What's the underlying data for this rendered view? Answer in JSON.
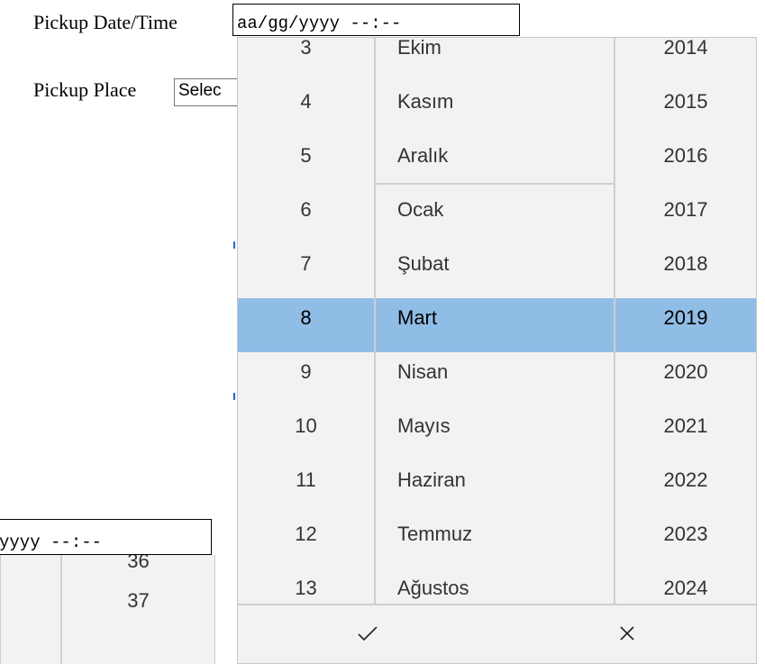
{
  "form": {
    "pickup_date_label": "Pickup Date/Time",
    "pickup_date_value": "aa/gg/yyyy --:--",
    "pickup_place_label": "Pickup Place",
    "pickup_place_value": "Selec"
  },
  "second_input": {
    "value": "yyyy --:--",
    "minutes": [
      "36",
      "37"
    ]
  },
  "picker": {
    "days": [
      "3",
      "4",
      "5",
      "6",
      "7",
      "8",
      "9",
      "10",
      "11",
      "12",
      "13"
    ],
    "months": [
      "Ekim",
      "Kasım",
      "Aralık",
      "Ocak",
      "Şubat",
      "Mart",
      "Nisan",
      "Mayıs",
      "Haziran",
      "Temmuz",
      "Ağustos"
    ],
    "years": [
      "2014",
      "2015",
      "2016",
      "2017",
      "2018",
      "2019",
      "2020",
      "2021",
      "2022",
      "2023",
      "2024"
    ],
    "selected": {
      "day": "8",
      "month": "Mart",
      "year": "2019"
    },
    "selected_color": "#90bde6",
    "confirm_icon": "check-icon",
    "cancel_icon": "close-icon"
  }
}
